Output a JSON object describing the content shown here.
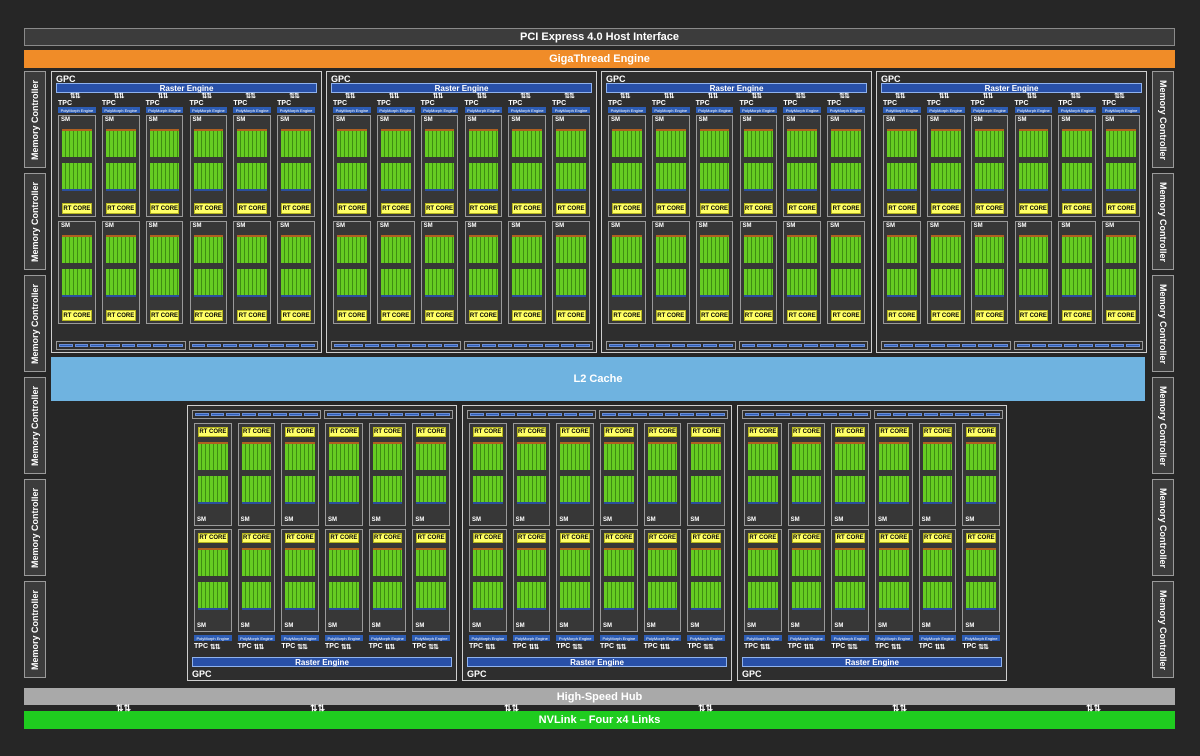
{
  "header": {
    "pcie": "PCI Express 4.0 Host Interface",
    "gigathread": "GigaThread Engine"
  },
  "l2": "L2 Cache",
  "hub": "High-Speed Hub",
  "nvlink": "NVLink – Four x4 Links",
  "memory_controller": "Memory Controller",
  "gpc": {
    "label": "GPC",
    "raster": "Raster Engine",
    "tpc": "TPC",
    "polymorph": "PolyMorph Engine",
    "sm": "SM",
    "rt_core": "RT CORE"
  },
  "colors": {
    "pcie": "#3c3c3c",
    "gigathread": "#f08c28",
    "l2": "#6fb3e0",
    "hub": "#a9a9a9",
    "nvlink": "#1fcc1f",
    "rt_core": "#ffff66",
    "cuda_core": "#66cc22",
    "raster": "#2850a8"
  }
}
